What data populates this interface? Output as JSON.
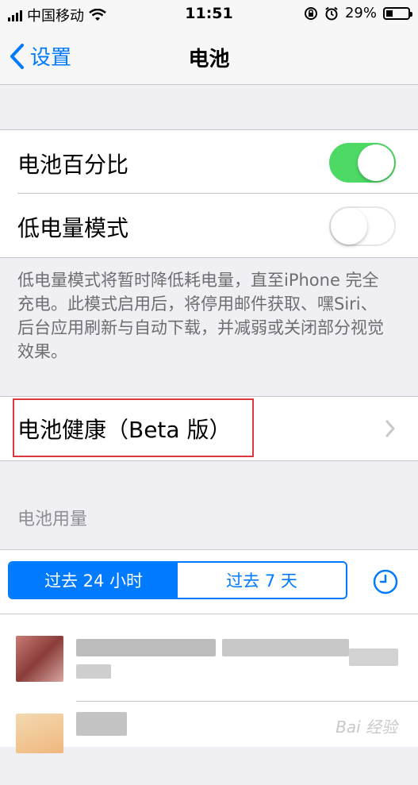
{
  "status_bar": {
    "carrier": "中国移动",
    "time": "11:51",
    "battery_percent": "29%",
    "battery_level": 0.29
  },
  "nav": {
    "back_label": "设置",
    "title": "电池"
  },
  "settings": {
    "battery_percentage": {
      "label": "电池百分比",
      "enabled": true
    },
    "low_power_mode": {
      "label": "低电量模式",
      "enabled": false
    }
  },
  "low_power_footer": "低电量模式将暂时降低耗电量，直至iPhone 完全充电。此模式启用后，将停用邮件获取、嘿Siri、后台应用刷新与自动下载，并减弱或关闭部分视觉效果。",
  "battery_health": {
    "label": "电池健康（Beta 版）"
  },
  "usage": {
    "section_header": "电池用量",
    "segments": [
      {
        "label": "过去 24 小时",
        "active": true
      },
      {
        "label": "过去 7 天",
        "active": false
      }
    ]
  },
  "colors": {
    "accent": "#007aff",
    "toggle_on": "#4cd964",
    "highlight": "#d9393f"
  },
  "watermark": "Bai 经验"
}
